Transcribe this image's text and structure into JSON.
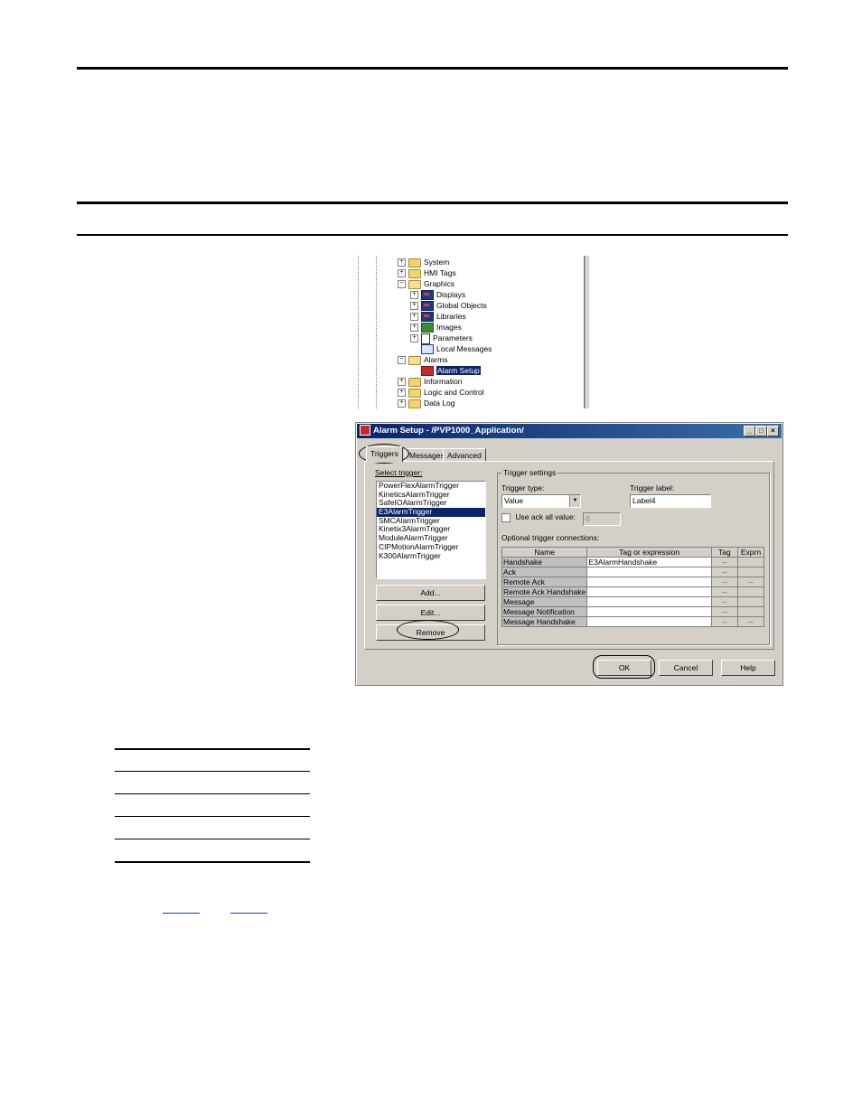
{
  "tree": {
    "items": [
      {
        "label": "System",
        "expander": "+",
        "icon": "folder-icon"
      },
      {
        "label": "HMI Tags",
        "expander": "+",
        "icon": "folder-icon"
      },
      {
        "label": "Graphics",
        "expander": "−",
        "icon": "open-folder-icon"
      },
      {
        "label": "Displays",
        "expander": "+",
        "icon": "display-icon"
      },
      {
        "label": "Global Objects",
        "expander": "+",
        "icon": "display-icon"
      },
      {
        "label": "Libraries",
        "expander": "+",
        "icon": "display-icon"
      },
      {
        "label": "Images",
        "expander": "+",
        "icon": "image-icon"
      },
      {
        "label": "Parameters",
        "expander": "+",
        "icon": "parameter-icon"
      },
      {
        "label": "Local Messages",
        "expander": "",
        "icon": "message-icon"
      },
      {
        "label": "Alarms",
        "expander": "−",
        "icon": "open-folder-icon"
      },
      {
        "label": "Alarm Setup",
        "expander": "",
        "icon": "alarm-icon"
      },
      {
        "label": "Information",
        "expander": "+",
        "icon": "folder-icon"
      },
      {
        "label": "Logic and Control",
        "expander": "+",
        "icon": "folder-icon"
      },
      {
        "label": "Data Log",
        "expander": "+",
        "icon": "folder-icon"
      }
    ]
  },
  "dialog": {
    "title": "Alarm Setup - /PVP1000_Application/",
    "title_buttons": {
      "minimize": "_",
      "maximize": "□",
      "close": "×"
    },
    "tabs": [
      "Triggers",
      "Messages",
      "Advanced"
    ],
    "select_trigger_label": "Select trigger:",
    "triggers": [
      "PowerFlexAlarmTrigger",
      "KineticsAlarmTrigger",
      "SafeIOAlarmTrigger",
      "E3AlarmTrigger",
      "SMCAlarmTrigger",
      "Kinetix3AlarmTrigger",
      "ModuleAlarmTrigger",
      "CIPMotionAlarmTrigger",
      "K300AlarmTrigger"
    ],
    "selected_trigger": "E3AlarmTrigger",
    "buttons": {
      "add": "Add...",
      "edit": "Edit...",
      "remove": "Remove",
      "ok": "OK",
      "cancel": "Cancel",
      "help": "Help"
    },
    "trigger_settings": {
      "group_label": "Trigger settings",
      "trigger_type_label": "Trigger type:",
      "trigger_type_value": "Value",
      "trigger_label_label": "Trigger label:",
      "trigger_label_value": "Label4",
      "use_ack_all_label": "Use ack all value:",
      "use_ack_all_value": "0",
      "optional_connections_label": "Optional trigger connections:",
      "columns": [
        "Name",
        "Tag or expression",
        "Tag",
        "Exprn"
      ],
      "rows": [
        {
          "name": "Handshake",
          "tag": "E3AlarmHandshake",
          "exprn": ""
        },
        {
          "name": "Ack",
          "tag": "",
          "exprn": ""
        },
        {
          "name": "Remote Ack",
          "tag": "",
          "exprn": "..."
        },
        {
          "name": "Remote Ack Handshake",
          "tag": "",
          "exprn": ""
        },
        {
          "name": "Message",
          "tag": "",
          "exprn": ""
        },
        {
          "name": "Message Notification",
          "tag": "",
          "exprn": ""
        },
        {
          "name": "Message Handshake",
          "tag": "",
          "exprn": "..."
        }
      ],
      "ellipsis": "..."
    }
  }
}
